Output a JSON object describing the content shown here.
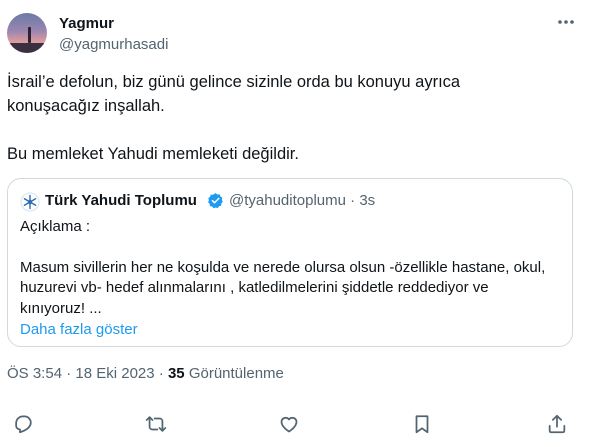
{
  "author": {
    "name": "Yagmur",
    "handle": "@yagmurhasadi",
    "avatar_icon": "sunset-silhouette-avatar"
  },
  "tweet": {
    "line1": "İsrail’e defolun, biz günü gelince sizinle orda bu konuyu ayrıca",
    "line2": "konuşacağız inşallah.",
    "line3": "Bu memleket Yahudi memleketi değildir."
  },
  "quote": {
    "name": "Türk Yahudi Toplumu",
    "handle": "@tyahuditoplumu",
    "separator": "·",
    "time": "3s",
    "verified_color": "#1d9bf0",
    "body_title": "Açıklama :",
    "body_line1": "Masum sivillerin her ne koşulda ve nerede olursa olsun -özellikle hastane, okul,",
    "body_line2": "huzurevi vb- hedef alınmalarını , katledilmelerini şiddetle reddediyor ve",
    "body_line3": "kınıyoruz! ...",
    "show_more": "Daha fazla göster"
  },
  "meta": {
    "time": "ÖS 3:54",
    "dot1": "·",
    "date": "18 Eki 2023",
    "dot2": "·",
    "views_count": "35",
    "views_label": "Görüntülenme"
  },
  "colors": {
    "text": "#0f1419",
    "secondary": "#536471",
    "link": "#1d9bf0",
    "border": "#cfd9de"
  },
  "actions": [
    "reply-icon",
    "retweet-icon",
    "like-icon",
    "bookmark-icon",
    "share-icon"
  ]
}
